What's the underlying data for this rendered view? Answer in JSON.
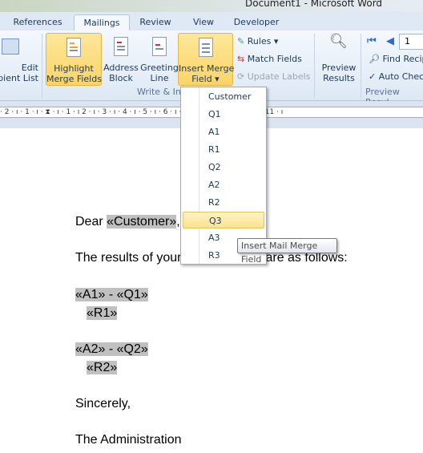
{
  "window": {
    "title": "Document1  -  Microsoft Word"
  },
  "tabs": [
    {
      "label": "References"
    },
    {
      "label": "Mailings",
      "active": true
    },
    {
      "label": "Review"
    },
    {
      "label": "View"
    },
    {
      "label": "Developer"
    }
  ],
  "ribbon": {
    "edit_recipient_list": "Edit\nipient List",
    "highlight_merge_fields": "Highlight\nMerge Fields",
    "address_block": "Address\nBlock",
    "greeting_line": "Greeting\nLine",
    "insert_merge_field": "Insert Merge\nField ▾",
    "rules": "Rules ▾",
    "match_fields": "Match Fields",
    "update_labels": "Update Labels",
    "group_write_insert": "Write & In",
    "preview_results": "Preview\nResults",
    "record_number": "1",
    "find_recipient": "Find Recip",
    "auto_check": "Auto Chec",
    "group_preview": "Preview Resul"
  },
  "ruler": {
    "ticks": "· 2 · ı · 1 · ı ·  ⧗  · ı · 1 · ı 2 · ı · 3 · ı · 4 · ı · 5 · ı · 6 · ı · 7 · ı · 8 · ı · 9 · ı 10 · ı · 11 · ı"
  },
  "menu": {
    "items": [
      "Customer",
      "Q1",
      "A1",
      "R1",
      "Q2",
      "A2",
      "R2",
      "Q3",
      "A3",
      "R3"
    ],
    "highlighted": "Q3"
  },
  "tooltip": "Insert Mail Merge Field",
  "document": {
    "greeting_prefix": "Dear ",
    "customer_field": "«Customer»",
    "greeting_suffix": ",",
    "intro": "The results of your questionnaire are as follows:",
    "a1": "«A1»",
    "q1": "«Q1»",
    "r1": "«R1»",
    "a2": "«A2»",
    "q2": "«Q2»",
    "r2": "«R2»",
    "dash": " - ",
    "closing": "Sincerely,",
    "signature": "The Administration"
  }
}
